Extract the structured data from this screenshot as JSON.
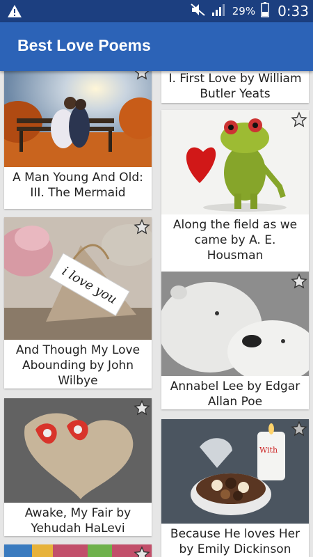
{
  "status_bar": {
    "battery_percent": "29%",
    "time": "0:33",
    "icons": [
      "warning-icon",
      "mute-icon",
      "signal-icon",
      "battery-icon"
    ]
  },
  "app_bar": {
    "title": "Best Love Poems"
  },
  "cards": [
    {
      "title": "A Man Young And Old: III. The Mermaid",
      "lines": [
        "A Man Young And Old:",
        "III. The Mermaid"
      ],
      "image": "couple-on-bench-autumn"
    },
    {
      "title": "I. First Love by William Butler Yeats",
      "lines": [
        "I. First Love by William",
        "Butler Yeats"
      ],
      "image": ""
    },
    {
      "title": "Along the field as we came by A. E. Housman",
      "lines": [
        "Along the field as we",
        "came by A. E.",
        "Housman"
      ],
      "image": "frog-with-heart"
    },
    {
      "title": "And Though My Love Abounding by John Wilbye",
      "lines": [
        "And Though My Love",
        "Abounding by John",
        "Wilbye"
      ],
      "image": "i-love-you-tag"
    },
    {
      "title": "Annabel Lee by Edgar Allan Poe",
      "lines": [
        "Annabel Lee by Edgar",
        "Allan Poe"
      ],
      "image": "polar-bears"
    },
    {
      "title": "Awake, My Fair by Yehudah HaLevi",
      "lines": [
        "Awake, My Fair by",
        "Yehudah HaLevi"
      ],
      "image": "wooden-heart-mice"
    },
    {
      "title": "Because He loves Her by Emily Dickinson",
      "lines": [
        "Because He loves Her",
        "by Emily Dickinson"
      ],
      "image": "heart-box-chocolates-candle"
    }
  ],
  "colors": {
    "status_bar": "#1c3f80",
    "app_bar": "#2c63b7",
    "background": "#e6e6e6"
  }
}
